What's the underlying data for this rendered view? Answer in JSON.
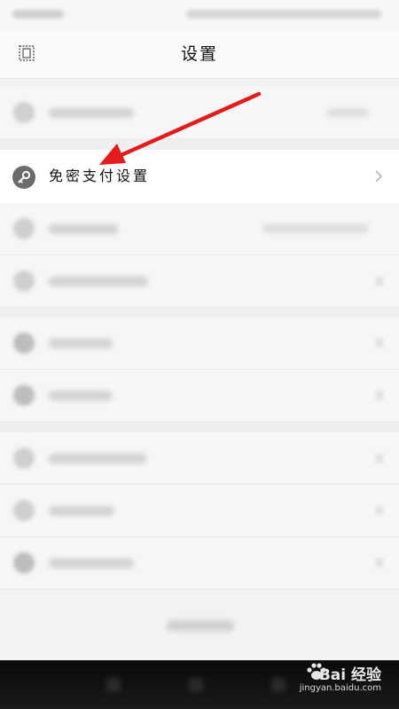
{
  "header": {
    "title": "设置",
    "back_icon": "back-icon"
  },
  "settings": {
    "active_item": {
      "label": "免密支付设置",
      "icon": "key-icon",
      "chevron": "chevron-right-icon"
    }
  },
  "watermark": {
    "brand": "Bai 经验",
    "url": "jingyan.baidu.com"
  },
  "colors": {
    "arrow": "#e31b1b",
    "icon_bg": "#6b6b6b",
    "background": "#f2f2f2"
  }
}
